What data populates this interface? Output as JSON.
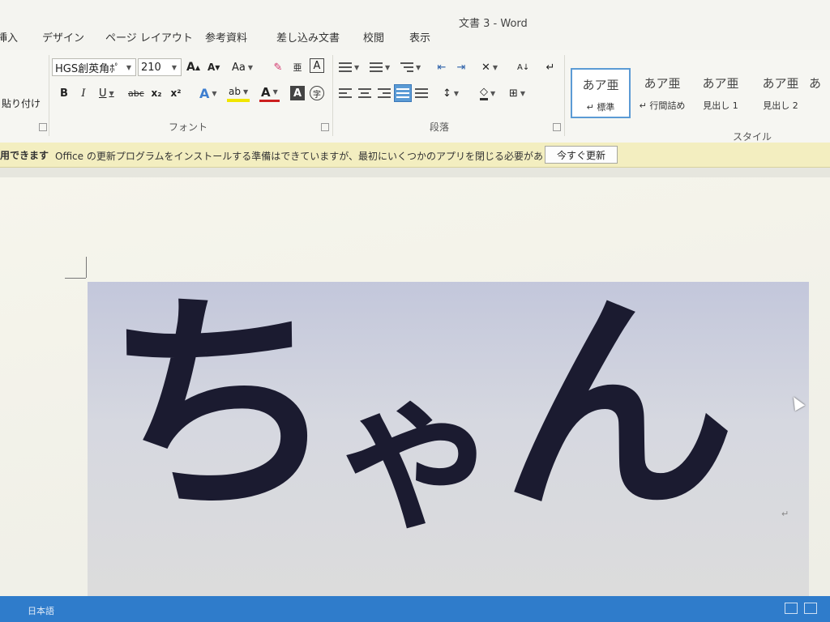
{
  "window": {
    "title": "文書 3 - Word"
  },
  "tabs": [
    {
      "label": "挿入"
    },
    {
      "label": "デザイン"
    },
    {
      "label": "ページ レイアウト"
    },
    {
      "label": "参考資料"
    },
    {
      "label": "差し込み文書"
    },
    {
      "label": "校閲"
    },
    {
      "label": "表示"
    }
  ],
  "clipboard": {
    "paste_label": "貼り付け"
  },
  "font": {
    "group_label": "フォント",
    "font_name": "HGS創英角ﾎﾟ",
    "font_size": "210",
    "grow_label": "A",
    "shrink_label": "A",
    "case_label": "Aa",
    "bold_label": "B",
    "italic_label": "I",
    "underline_label": "U",
    "strike_label": "abc",
    "subscript_label": "x₂",
    "superscript_label": "x²",
    "effects_label": "A",
    "highlight_label": "ab",
    "color_label": "A",
    "shade_label": "A",
    "border_label": "A",
    "enclose_label": "字",
    "phonetic_label": "亜"
  },
  "paragraph": {
    "group_label": "段落"
  },
  "styles": {
    "group_label": "スタイル",
    "items": [
      {
        "sample": "あア亜",
        "name": "↵ 標準",
        "selected": true
      },
      {
        "sample": "あア亜",
        "name": "↵ 行間詰め",
        "selected": false
      },
      {
        "sample": "あア亜",
        "name": "見出し 1",
        "selected": false
      },
      {
        "sample": "あア亜",
        "name": "見出し 2",
        "selected": false
      },
      {
        "sample": "あ",
        "name": "",
        "selected": false
      }
    ]
  },
  "notification": {
    "title": "用できます",
    "message": "Office の更新プログラムをインストールする準備はできていますが、最初にいくつかのアプリを閉じる必要があります。",
    "button_label": "今すぐ更新"
  },
  "document": {
    "text_parts": [
      "ち",
      "ゃ",
      "ん"
    ],
    "paragraph_mark": "↵"
  },
  "status": {
    "language": "日本語"
  },
  "colors": {
    "status_bar": "#2f7ccb",
    "notification_bg": "#f3eec0",
    "active_align": "#5b9bd5",
    "text": "#1b1b30"
  }
}
